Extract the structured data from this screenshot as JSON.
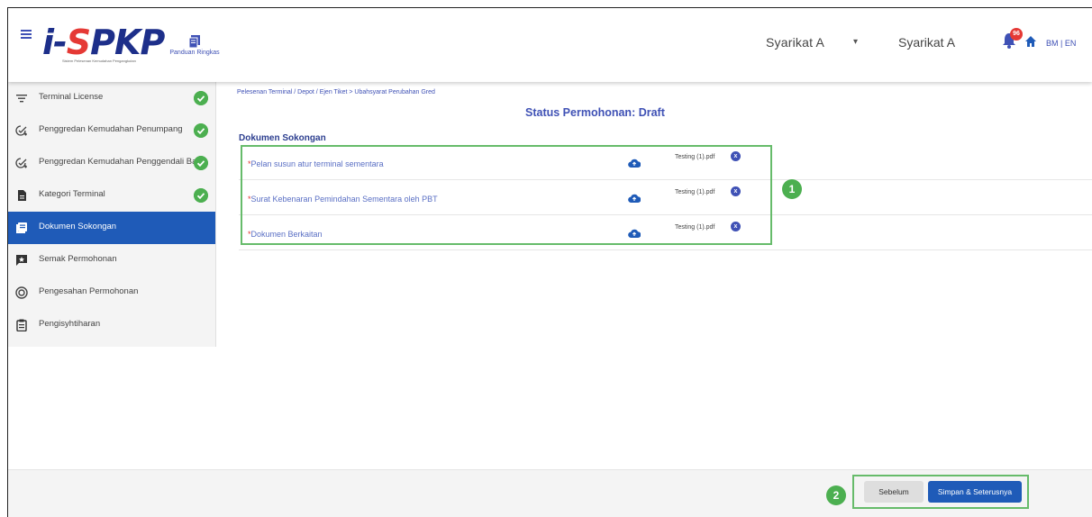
{
  "header": {
    "logo_text": "i-SPKP",
    "logo_subtitle": "Sistem Pelesenan Kemudahan Pengangkutan",
    "guide_label": "Panduan Ringkas",
    "company_name": "Syarikat A",
    "company_select_value": "Syarikat A",
    "notification_count": "96",
    "lang_bm": "BM",
    "lang_separator": "|",
    "lang_en": "EN"
  },
  "sidebar": {
    "items": [
      {
        "label": "Terminal License",
        "icon": "filter-list-icon",
        "completed": true,
        "active": false
      },
      {
        "label": "Penggredan Kemudahan Penumpang",
        "icon": "grade-check-icon",
        "completed": true,
        "active": false
      },
      {
        "label": "Penggredan Kemudahan Penggendali Bas",
        "icon": "grade-check-icon",
        "completed": true,
        "active": false
      },
      {
        "label": "Kategori Terminal",
        "icon": "document-icon",
        "completed": true,
        "active": false
      },
      {
        "label": "Dokumen Sokongan",
        "icon": "library-books-icon",
        "completed": false,
        "active": true
      },
      {
        "label": "Semak Permohonan",
        "icon": "review-icon",
        "completed": false,
        "active": false
      },
      {
        "label": "Pengesahan Permohonan",
        "icon": "verified-icon",
        "completed": false,
        "active": false
      },
      {
        "label": "Pengisyhtiharan",
        "icon": "clipboard-icon",
        "completed": false,
        "active": false
      }
    ]
  },
  "main": {
    "breadcrumb": "Pelesenan Terminal / Depot / Ejen Tiket > Ubahsyarat Perubahan Gred",
    "status_title": "Status Permohonan: Draft",
    "section_heading": "Dokumen Sokongan",
    "documents": [
      {
        "required_mark": "*",
        "label": "Pelan susun atur terminal sementara",
        "file_name": "Testing (1).pdf"
      },
      {
        "required_mark": "*",
        "label": "Surat Kebenaran Pemindahan Sementara oleh PBT",
        "file_name": "Testing (1).pdf"
      },
      {
        "required_mark": "*",
        "label": "Dokumen Berkaitan",
        "file_name": "Testing (1).pdf"
      }
    ]
  },
  "callouts": {
    "one": "1",
    "two": "2"
  },
  "footer": {
    "prev_label": "Sebelum",
    "next_label": "Simpan & Seterusnya"
  },
  "colors": {
    "primary": "#1f5bb8",
    "accent": "#3f51b5",
    "success": "#4caf50",
    "highlight_border": "#66bb6a",
    "badge_red": "#e53935"
  }
}
